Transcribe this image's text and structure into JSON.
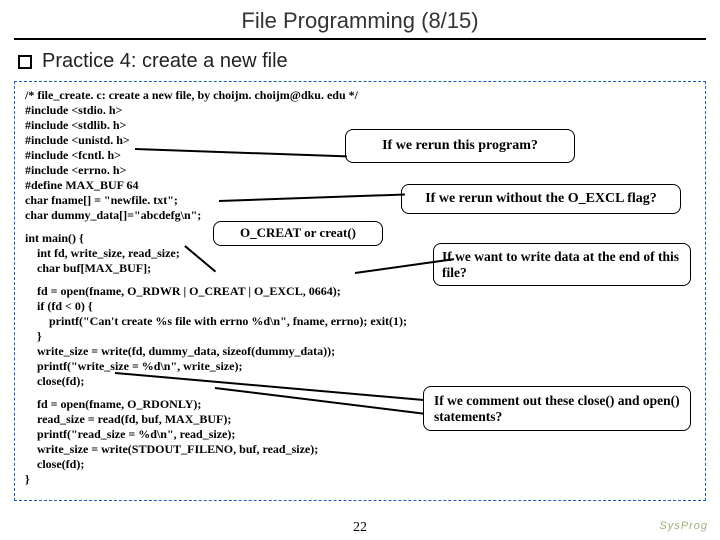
{
  "title": "File Programming (8/15)",
  "heading": "Practice 4: create a new file",
  "code": {
    "l01": "/* file_create. c: create a new file, by choijm. choijm@dku. edu */",
    "l02": "#include <stdio. h>",
    "l03": "#include <stdlib. h>",
    "l04": "#include <unistd. h>",
    "l05": "#include <fcntl. h>",
    "l06": "#include <errno. h>",
    "l07": "#define MAX_BUF 64",
    "l08": "char fname[] = \"newfile. txt\";",
    "l09": "char dummy_data[]=\"abcdefg\\n\";",
    "l10": "int main() {",
    "l11": "    int fd, write_size, read_size;",
    "l12": "    char buf[MAX_BUF];",
    "l13": "    fd = open(fname, O_RDWR | O_CREAT | O_EXCL, 0664);",
    "l14": "    if (fd < 0) {",
    "l15": "        printf(\"Can't create %s file with errno %d\\n\", fname, errno); exit(1);",
    "l16": "    }",
    "l17": "    write_size = write(fd, dummy_data, sizeof(dummy_data));",
    "l18": "    printf(\"write_size = %d\\n\", write_size);",
    "l19": "    close(fd);",
    "l20": "    fd = open(fname, O_RDONLY);",
    "l21": "    read_size = read(fd, buf, MAX_BUF);",
    "l22": "    printf(\"read_size = %d\\n\", read_size);",
    "l23": "    write_size = write(STDOUT_FILENO, buf, read_size);",
    "l24": "    close(fd);",
    "l25": "}"
  },
  "callouts": {
    "c1": "If we rerun this program?",
    "c2": "If we rerun without the O_EXCL flag?",
    "c3": "O_CREAT or creat()",
    "c4": "If we want to write data at the end of this file?",
    "c5": "If we comment out these close() and open() statements?"
  },
  "pagenum": "22",
  "logo": "SysProg"
}
